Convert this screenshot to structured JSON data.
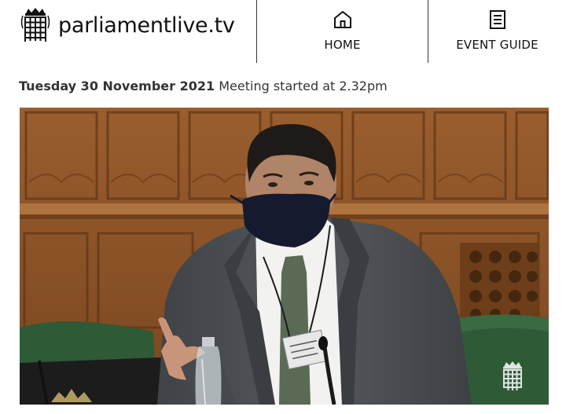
{
  "site": {
    "name": "parliamentlive.tv",
    "logo_icon": "portcullis-icon"
  },
  "nav": {
    "home_label": "HOME",
    "home_icon": "home-icon",
    "event_guide_label": "EVENT GUIDE",
    "event_guide_icon": "document-list-icon"
  },
  "meeting": {
    "date": "Tuesday 30 November 2021",
    "status": "Meeting started at 2.32pm"
  },
  "video": {
    "watermark_icon": "portcullis-icon",
    "colors": {
      "panel_wood": "#8a5228",
      "bench_green": "#2f5a36",
      "jacket": "#4b4e52",
      "shirt": "#f2f2f0"
    }
  }
}
